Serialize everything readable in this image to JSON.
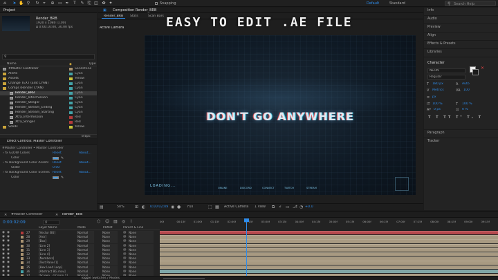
{
  "banner": "EASY TO EDIT .AE FILE",
  "toolbar": {
    "snapping": "Snapping",
    "workspace_default": "Default",
    "workspace_standard": "Standard",
    "search_help": "Search Help"
  },
  "project": {
    "title": "Project",
    "selected_name": "Render_BRB",
    "selected_size": "1920 x 1080 (1.00)",
    "selected_duration": "Δ 0:00:10:00, 30.00 fps",
    "col_name": "Name",
    "col_type": "Type",
    "items": [
      {
        "name": "#Master Controller",
        "label": "Sandstone",
        "color": "#a89270",
        "kind": "comp"
      },
      {
        "name": "Alerts",
        "label": "Cyan",
        "color": "#43a3a8",
        "kind": "folder"
      },
      {
        "name": "Assets",
        "label": "Yellow",
        "color": "#c9c33a",
        "kind": "folder"
      },
      {
        "name": "Change TEXT (Edit CYAN)",
        "label": "Cyan",
        "color": "#43a3a8",
        "kind": "folder"
      },
      {
        "name": "Comps (Render CYAN)",
        "label": "Cyan",
        "color": "#43a3a8",
        "kind": "folder"
      },
      {
        "name": "Render_BRB",
        "label": "Cyan",
        "color": "#43a3a8",
        "kind": "comp"
      },
      {
        "name": "Render_Intermission",
        "label": "Cyan",
        "color": "#43a3a8",
        "kind": "comp"
      },
      {
        "name": "Render_Stinger",
        "label": "Cyan",
        "color": "#43a3a8",
        "kind": "comp"
      },
      {
        "name": "Render_Stream_Ending",
        "label": "Cyan",
        "color": "#43a3a8",
        "kind": "comp"
      },
      {
        "name": "Render_Stream_Starting",
        "label": "Cyan",
        "color": "#43a3a8",
        "kind": "comp"
      },
      {
        "name": "Xtra_Intermission",
        "label": "Red",
        "color": "#b33a3a",
        "kind": "comp"
      },
      {
        "name": "Xtra_Stinger",
        "label": "Red",
        "color": "#b33a3a",
        "kind": "comp"
      },
      {
        "name": "Solids",
        "label": "Yellow",
        "color": "#c9c33a",
        "kind": "folder"
      }
    ],
    "bpc": "8 bpc"
  },
  "effects": {
    "title": "Effect Controls: Master Controller",
    "subtitle": "#Master Controller • Master Controller",
    "items": [
      {
        "name": "GLOW Colors",
        "reset": "Reset",
        "about": "About..."
      },
      {
        "name": "Color",
        "reset": "",
        "about": ""
      },
      {
        "name": "Background Color Assets",
        "reset": "Reset",
        "about": "About..."
      },
      {
        "name": "Slider",
        "value": "0.00"
      },
      {
        "name": "Background Color Scenes",
        "reset": "Reset",
        "about": "About..."
      },
      {
        "name": "Color",
        "reset": "",
        "about": ""
      }
    ]
  },
  "comp": {
    "tab_title": "Composition Render_BRB",
    "tabs": [
      "Render_BRB",
      "Stats",
      "Scan Bars"
    ],
    "active_camera": "Active Camera",
    "headline": "DON'T GO ANYWHERE",
    "loading": "LOADING...",
    "socials": [
      "ONLINE",
      "DISCORD",
      "CONNECT",
      "TWITCH",
      "STREAM"
    ],
    "footer": {
      "zoom": "50%",
      "timecode": "0:00:02:09",
      "resolution": "Full",
      "camera": "Active Camera",
      "views": "1 View",
      "exposure": "+0.0"
    }
  },
  "right": {
    "sections": [
      "Info",
      "Audio",
      "Preview",
      "Align",
      "Effects & Presets",
      "Libraries"
    ],
    "character": {
      "title": "Character",
      "font": "NEON",
      "style": "Regular",
      "size": "180 px",
      "leading": "Auto",
      "tracking": "100",
      "kerning": "Metrics",
      "stroke": "px",
      "vscale": "100 %",
      "hscale": "100 %",
      "baseline": "0 px",
      "tsume": "0 %"
    },
    "bottom_sections": [
      "Paragraph",
      "Tracker"
    ]
  },
  "timeline": {
    "tabs": [
      "#Master Controller",
      "Render_BRB"
    ],
    "timecode": "0:00:02:09",
    "col_layer": "Layer Name",
    "col_mode": "Mode",
    "col_trkmat": "TrkMat",
    "col_parent": "Parent & Link",
    "footer": "Toggle Switches / Modes",
    "ruler": [
      "00f",
      "00:15f",
      "01:00f",
      "01:15f",
      "02:00f",
      "02:15f",
      "03:00f",
      "03:15f",
      "04:00f",
      "04:15f",
      "05:00f",
      "05:15f",
      "06:00f",
      "06:15f",
      "07:00f",
      "07:15f",
      "08:00f",
      "08:15f",
      "09:00f",
      "09:15f",
      "10:0"
    ],
    "layers": [
      {
        "num": "27",
        "name": "[Vector BG]",
        "mode": "Normal",
        "trkmat": "None",
        "parent": "None",
        "color": "#b33a3a"
      },
      {
        "num": "28",
        "name": "[Ash]",
        "mode": "Normal",
        "trkmat": "None",
        "parent": "None",
        "color": "#a89270"
      },
      {
        "num": "29",
        "name": "[Box]",
        "mode": "Normal",
        "trkmat": "None",
        "parent": "None",
        "color": "#a89270"
      },
      {
        "num": "30",
        "name": "[Line 2]",
        "mode": "Normal",
        "trkmat": "None",
        "parent": "None",
        "color": "#a89270"
      },
      {
        "num": "31",
        "name": "[Line 3]",
        "mode": "Normal",
        "trkmat": "None",
        "parent": "None",
        "color": "#a89270"
      },
      {
        "num": "32",
        "name": "[Line 4]",
        "mode": "Normal",
        "trkmat": "None",
        "parent": "None",
        "color": "#a89270"
      },
      {
        "num": "33",
        "name": "[Numbers]",
        "mode": "Normal",
        "trkmat": "None",
        "parent": "None",
        "color": "#a89270"
      },
      {
        "num": "34",
        "name": "[Text Panel 1]",
        "mode": "Normal",
        "trkmat": "None",
        "parent": "None",
        "color": "#a89270"
      },
      {
        "num": "35",
        "name": "[Hex Load Loop]",
        "mode": "Normal",
        "trkmat": "None",
        "parent": "None",
        "color": "#a89270"
      },
      {
        "num": "36",
        "name": "[Abstract BG.mov]",
        "mode": "Normal",
        "trkmat": "None",
        "parent": "None",
        "color": "#43a3a8"
      },
      {
        "num": "37",
        "name": "[Screen...d Comp 1]",
        "mode": "Normal",
        "trkmat": "None",
        "parent": "None",
        "color": "#a89270"
      }
    ]
  },
  "colors": {
    "accent": "#2d8ceb",
    "playhead": "#2d8ceb",
    "track_red": "#b5484d",
    "track_tan": "#a89a82",
    "track_teal": "#7fa6a6"
  }
}
